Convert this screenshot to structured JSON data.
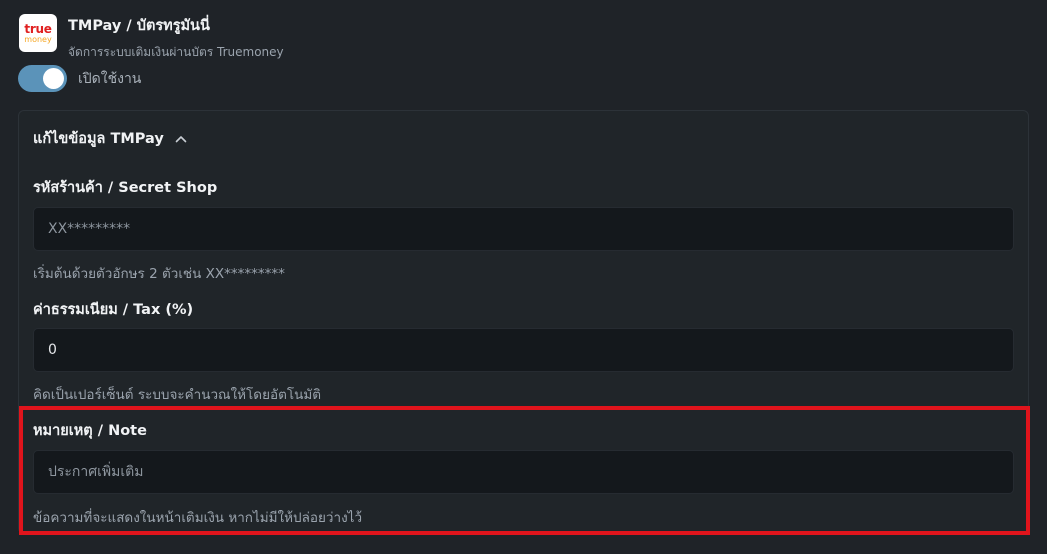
{
  "app": {
    "logo_top": "true",
    "logo_bottom": "money",
    "title": "TMPay / บัตรทรูมันนี่",
    "subtitle": "จัดการระบบเติมเงินผ่านบัตร Truemoney"
  },
  "toggle": {
    "label": "เปิดใช้งาน",
    "enabled": true,
    "accent": "#5b93b9"
  },
  "panel": {
    "header": "แก้ไขข้อมูล TMPay",
    "expanded": true,
    "fields": [
      {
        "label": "รหัสร้านค้า / Secret Shop",
        "placeholder": "XX*********",
        "value": "",
        "help": "เริ่มต้นด้วยตัวอักษร 2 ตัวเช่น XX*********"
      },
      {
        "label": "ค่าธรรมเนียม / Tax (%)",
        "placeholder": "",
        "value": "0",
        "help": "คิดเป็นเปอร์เซ็นต์ ระบบจะคำนวณให้โดยอัตโนมัติ"
      },
      {
        "label": "หมายเหตุ / Note",
        "placeholder": "ประกาศเพิ่มเติม",
        "value": "",
        "help": "ข้อความที่จะแสดงในหน้าเติมเงิน หากไม่มีให้ปล่อยว่างไว้"
      }
    ]
  },
  "colors": {
    "highlight": "#e0141c",
    "background": "#1f2328"
  }
}
